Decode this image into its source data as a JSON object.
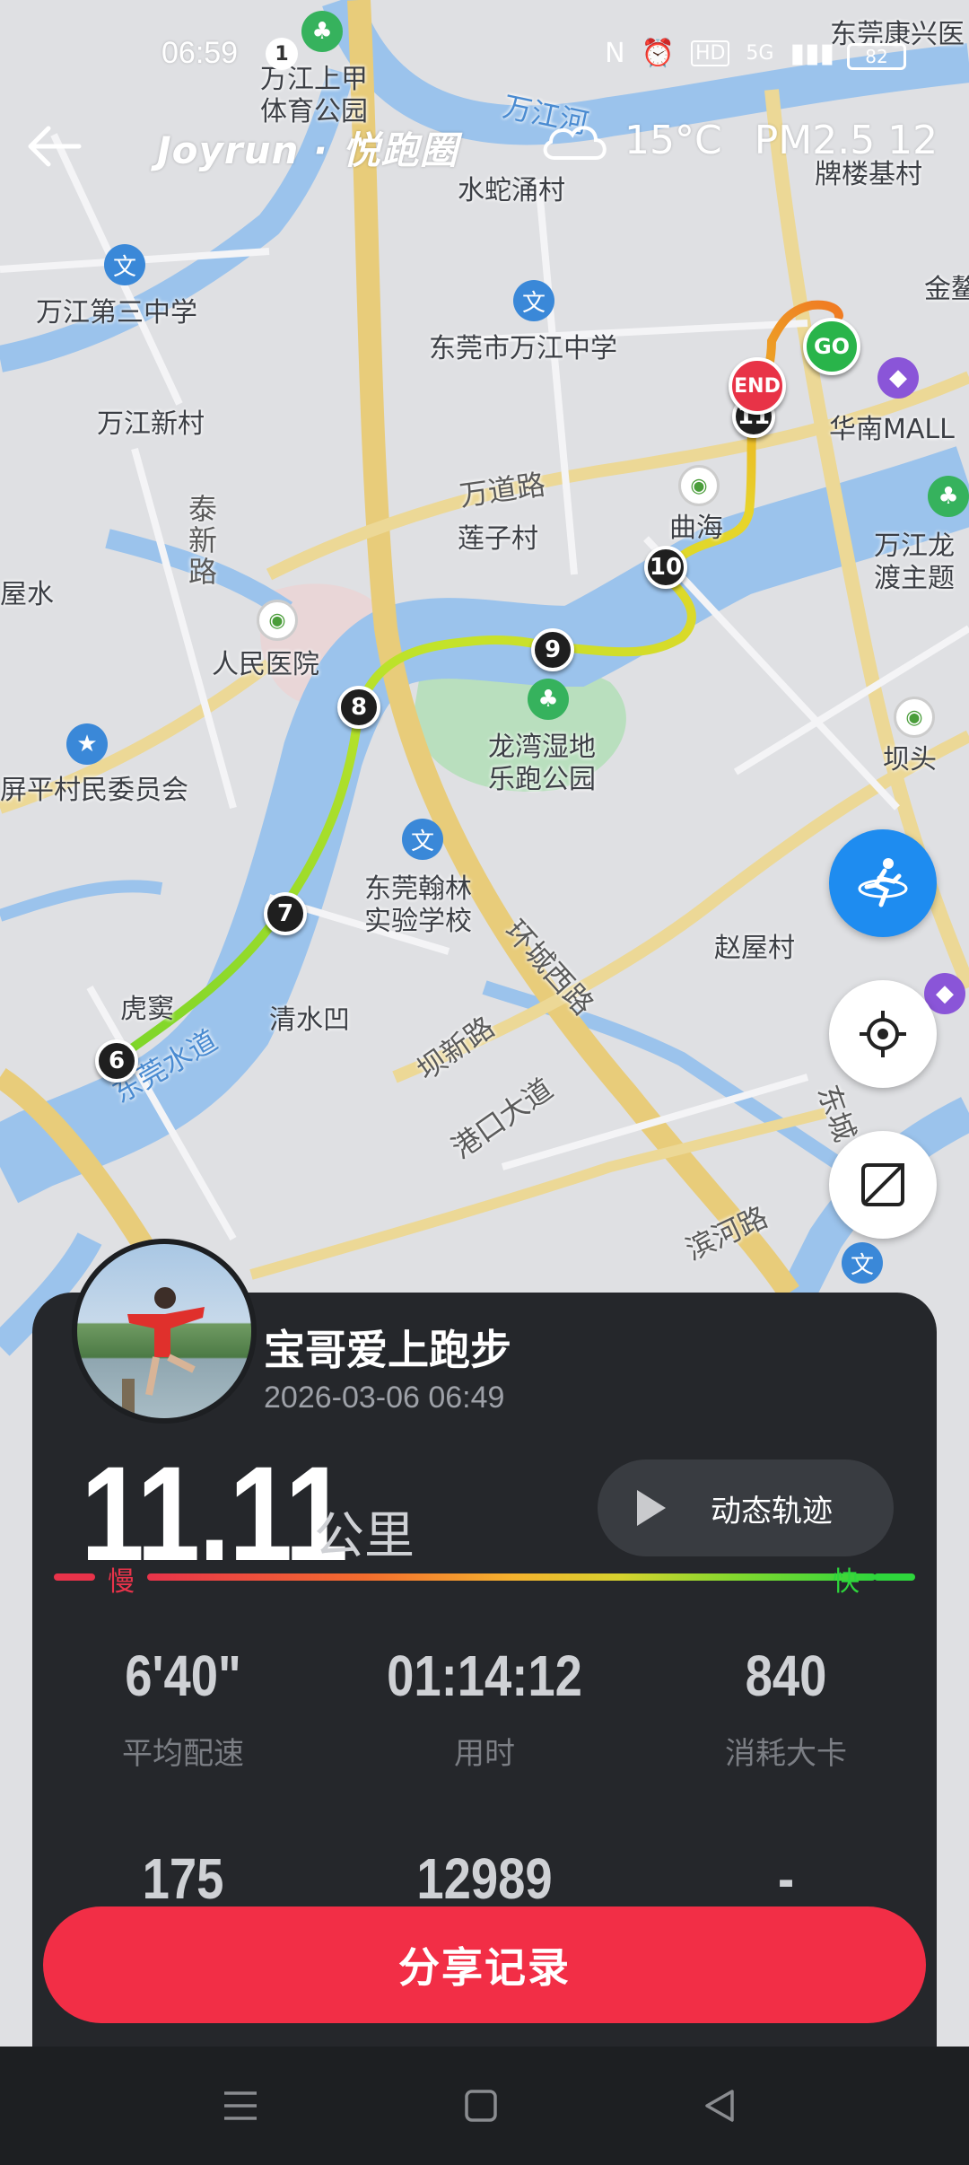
{
  "status_bar": {
    "time": "06:59",
    "notification_count": "1",
    "icons": [
      "nfc-icon",
      "alarm-icon",
      "hd-icon",
      "5g-signal-icon",
      "signal-icon"
    ],
    "network_label": "5G",
    "battery": "82"
  },
  "header": {
    "brand": "Joyrun · 悦跑圈",
    "weather_icon": "cloud-icon",
    "temperature": "15°C",
    "air_quality": "PM2.5 12"
  },
  "map": {
    "labels": [
      {
        "text": "东莞康兴医",
        "kind": "place"
      },
      {
        "text": "万江上甲",
        "kind": "place"
      },
      {
        "text": "体育公园",
        "kind": "place"
      },
      {
        "text": "万江河",
        "kind": "water"
      },
      {
        "text": "水蛇涌村",
        "kind": "place"
      },
      {
        "text": "牌楼基村",
        "kind": "place"
      },
      {
        "text": "金鳌",
        "kind": "place"
      },
      {
        "text": "万江第三中学",
        "kind": "place"
      },
      {
        "text": "东莞市万江中学",
        "kind": "place"
      },
      {
        "text": "万江新村",
        "kind": "place"
      },
      {
        "text": "华南MALL",
        "kind": "place"
      },
      {
        "text": "万道路",
        "kind": "road"
      },
      {
        "text": "莲子村",
        "kind": "place"
      },
      {
        "text": "曲海",
        "kind": "place"
      },
      {
        "text": "泰新路",
        "kind": "road"
      },
      {
        "text": "屋水",
        "kind": "place"
      },
      {
        "text": "万江龙",
        "kind": "place"
      },
      {
        "text": "渡主题",
        "kind": "place"
      },
      {
        "text": "人民医院",
        "kind": "place"
      },
      {
        "text": "龙湾湿地",
        "kind": "place"
      },
      {
        "text": "乐跑公园",
        "kind": "place"
      },
      {
        "text": "坝头",
        "kind": "place"
      },
      {
        "text": "屏平村民委员会",
        "kind": "place"
      },
      {
        "text": "东莞翰林",
        "kind": "place"
      },
      {
        "text": "实验学校",
        "kind": "place"
      },
      {
        "text": "赵屋村",
        "kind": "place"
      },
      {
        "text": "环城西路",
        "kind": "road"
      },
      {
        "text": "虎窦",
        "kind": "place"
      },
      {
        "text": "清水凹",
        "kind": "place"
      },
      {
        "text": "东莞水道",
        "kind": "water"
      },
      {
        "text": "坝新路",
        "kind": "road"
      },
      {
        "text": "港口大道",
        "kind": "road"
      },
      {
        "text": "滨河路",
        "kind": "road"
      },
      {
        "text": "东城",
        "kind": "place"
      }
    ],
    "km_markers": [
      "6",
      "7",
      "8",
      "9",
      "10",
      "11"
    ],
    "end_label": "END",
    "start_label": "GO"
  },
  "side_buttons": {
    "runner_icon": "runner-icon",
    "locate_icon": "locate-icon",
    "fullscreen_icon": "fullscreen-icon"
  },
  "card": {
    "username": "宝哥爱上跑步",
    "datetime": "2026-03-06 06:49",
    "distance": "11.11",
    "distance_unit": "公里",
    "track_button": "动态轨迹",
    "slow_label": "慢",
    "fast_label": "快",
    "stats_row1": [
      {
        "value": "6'40\"",
        "label": "平均配速"
      },
      {
        "value": "01:14:12",
        "label": "用时"
      },
      {
        "value": "840",
        "label": "消耗大卡"
      }
    ],
    "stats_row2": [
      {
        "value": "175"
      },
      {
        "value": "12989"
      },
      {
        "value": "-"
      }
    ],
    "share_button": "分享记录"
  },
  "nav_bar": {
    "menu_icon": "menu-icon",
    "home_icon": "home-icon",
    "back_icon": "back-triangle-icon"
  }
}
